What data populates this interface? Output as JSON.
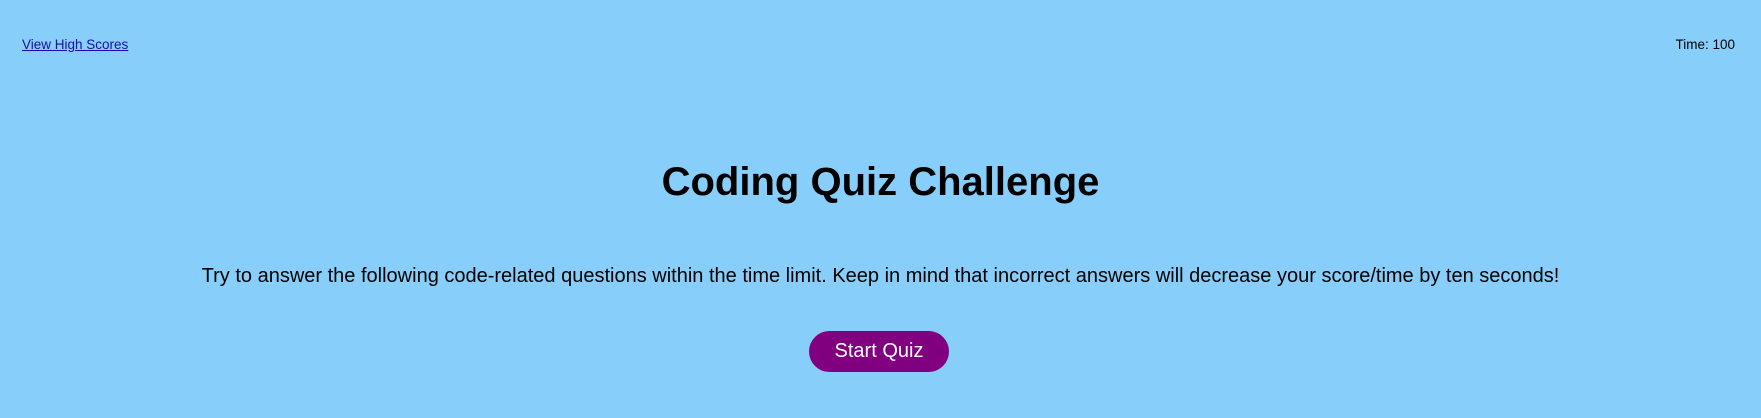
{
  "header": {
    "high_scores_link": "View High Scores",
    "timer_label": "Time: 100"
  },
  "main": {
    "title": "Coding Quiz Challenge",
    "description": "Try to answer the following code-related questions within the time limit. Keep in mind that incorrect answers will decrease your score/time by ten seconds!",
    "start_button": "Start Quiz"
  },
  "colors": {
    "background": "#87CEFA",
    "button": "#800080",
    "button_text": "#FFFFFF",
    "link": "#1A0DAB"
  }
}
